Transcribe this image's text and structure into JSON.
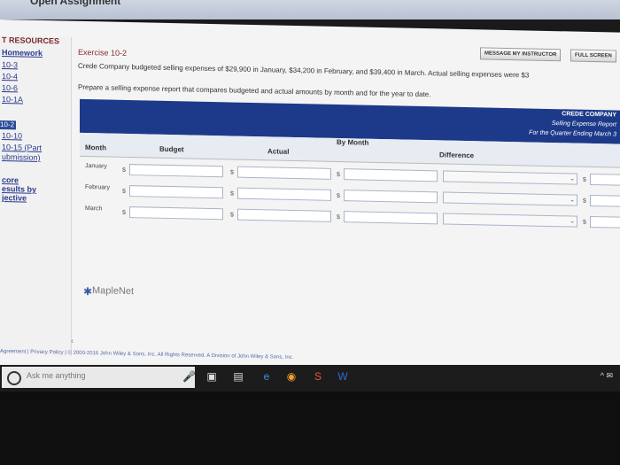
{
  "window": {
    "title": "Open Assignment"
  },
  "sidebar": {
    "heading": "T RESOURCES",
    "items": [
      {
        "label": "Homework"
      },
      {
        "label": "10-3"
      },
      {
        "label": "10-4"
      },
      {
        "label": "10-6"
      },
      {
        "label": "10-1A"
      },
      {
        "label": "10-2"
      },
      {
        "label": "10-10"
      },
      {
        "label": "10-15 (Part"
      },
      {
        "label": "ubmission)"
      },
      {
        "label": "core"
      },
      {
        "label": "esults by"
      },
      {
        "label": "jective"
      }
    ]
  },
  "header": {
    "message_button": "MESSAGE MY INSTRUCTOR",
    "fullscreen_button": "FULL SCREEN"
  },
  "exercise": {
    "title": "Exercise 10-2",
    "line1": "Crede Company budgeted selling expenses of $29,900 in January, $34,200 in February, and $39,400 in March. Actual selling expenses were $3",
    "line2": "Prepare a selling expense report that compares budgeted and actual amounts by month and for the year to date."
  },
  "report": {
    "company": "CREDE COMPANY",
    "title": "Selling Expense Report",
    "period": "For the Quarter Ending March 3",
    "group_header": "By Month",
    "col_month": "Month",
    "col_budget": "Budget",
    "col_actual": "Actual",
    "col_difference": "Difference",
    "rows": [
      {
        "month": "January"
      },
      {
        "month": "February"
      },
      {
        "month": "March"
      }
    ],
    "currency": "$"
  },
  "brand": {
    "name": "MapleNet"
  },
  "footer": {
    "text": "Agreement  |  Privacy Policy  |  © 2000-2016 John Wiley & Sons, Inc. All Rights Reserved. A Division of John Wiley & Sons, Inc."
  },
  "taskbar": {
    "search_placeholder": "Ask me anything"
  }
}
